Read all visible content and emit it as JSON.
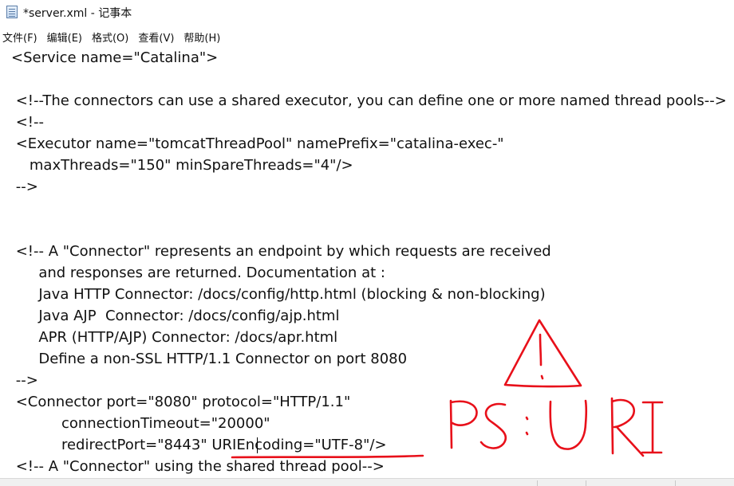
{
  "window": {
    "title": "*server.xml - 记事本"
  },
  "menu": {
    "items": [
      {
        "label": "文件(F)",
        "id": "file"
      },
      {
        "label": "编辑(E)",
        "id": "edit"
      },
      {
        "label": "格式(O)",
        "id": "format"
      },
      {
        "label": "查看(V)",
        "id": "view"
      },
      {
        "label": "帮助(H)",
        "id": "help"
      }
    ]
  },
  "editor": {
    "lines": [
      "<Service name=\"Catalina\">",
      "",
      " <!--The connectors can use a shared executor, you can define one or more named thread pools-->",
      " <!--",
      " <Executor name=\"tomcatThreadPool\" namePrefix=\"catalina-exec-\"",
      "    maxThreads=\"150\" minSpareThreads=\"4\"/>",
      " -->",
      "",
      "",
      " <!-- A \"Connector\" represents an endpoint by which requests are received",
      "      and responses are returned. Documentation at :",
      "      Java HTTP Connector: /docs/config/http.html (blocking & non-blocking)",
      "      Java AJP  Connector: /docs/config/ajp.html",
      "      APR (HTTP/AJP) Connector: /docs/apr.html",
      "      Define a non-SSL HTTP/1.1 Connector on port 8080",
      " -->",
      " <Connector port=\"8080\" protocol=\"HTTP/1.1\"",
      "           connectionTimeout=\"20000\"",
      "           redirectPort=\"8443\" URIEncoding=\"UTF-8\"/>",
      " <!-- A \"Connector\" using the shared thread pool-->"
    ]
  },
  "annotation": {
    "text": "PS : URI",
    "color": "#e8101a"
  }
}
